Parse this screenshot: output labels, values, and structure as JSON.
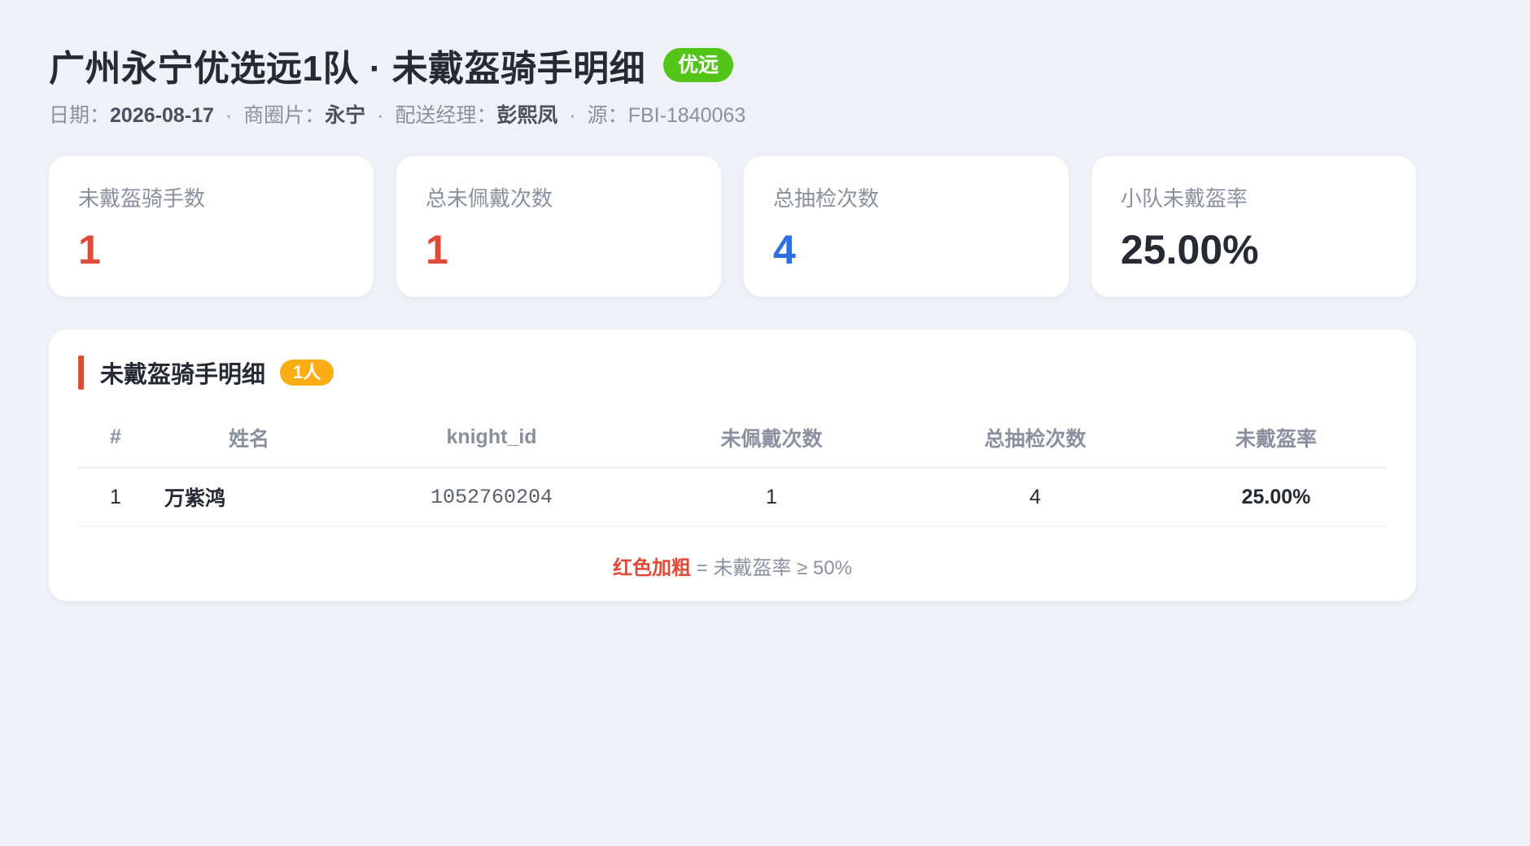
{
  "header": {
    "title": "广州永宁优选远1队 · 未戴盔骑手明细",
    "badge": "优远",
    "badge_color": "#52c41a"
  },
  "meta": {
    "date_label": "日期：",
    "date": "2026-08-17",
    "district_label": "商圈片：",
    "district": "永宁",
    "manager_label": "配送经理：",
    "manager": "彭熙凤",
    "source_label": "源：",
    "source": "FBI-1840063",
    "separator": "·"
  },
  "stats": [
    {
      "label": "未戴盔骑手数",
      "value": "1",
      "color": "#e04a39"
    },
    {
      "label": "总未佩戴次数",
      "value": "1",
      "color": "#e04a39"
    },
    {
      "label": "总抽检次数",
      "value": "4",
      "color": "#2f6ee0"
    },
    {
      "label": "小队未戴盔率",
      "value": "25.00%",
      "color": "#262a33"
    }
  ],
  "panel": {
    "title": "未戴盔骑手明细",
    "count_badge": "1人",
    "columns": [
      "#",
      "姓名",
      "knight_id",
      "未佩戴次数",
      "总抽检次数",
      "未戴盔率"
    ],
    "rows": [
      {
        "idx": "1",
        "name": "万紫鸿",
        "knight_id": "1052760204",
        "missed": "1",
        "total": "4",
        "rate": "25.00%"
      }
    ],
    "legend_key": "红色加粗",
    "legend_text": " = 未戴盔率 ≥ 50%"
  }
}
